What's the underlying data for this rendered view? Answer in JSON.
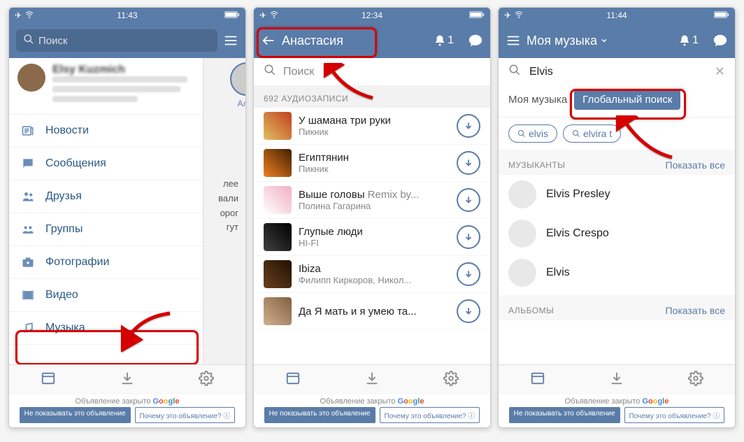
{
  "screen1": {
    "status_time": "11:43",
    "search_placeholder": "Поиск",
    "news": {
      "name": "Elsy Kuzmich",
      "story_name": "Алек"
    },
    "menu": [
      {
        "icon": "newspaper",
        "label": "Новости"
      },
      {
        "icon": "message",
        "label": "Сообщения"
      },
      {
        "icon": "users",
        "label": "Друзья"
      },
      {
        "icon": "group",
        "label": "Группы"
      },
      {
        "icon": "camera",
        "label": "Фотографии"
      },
      {
        "icon": "film",
        "label": "Видео"
      },
      {
        "icon": "music",
        "label": "Музыка"
      }
    ],
    "behind_text": "лее\nвали\nорог\nгут"
  },
  "screen2": {
    "status_time": "12:34",
    "title": "Анастасия",
    "bell_count": "1",
    "search_placeholder": "Поиск",
    "section": "692 АУДИОЗАПИСИ",
    "tracks": [
      {
        "title": "У шамана три руки",
        "artist": "Пикник",
        "grey": ""
      },
      {
        "title": "Египтянин",
        "artist": "Пикник",
        "grey": ""
      },
      {
        "title": "Выше головы",
        "artist": "Полина Гагарина",
        "grey": " Remix by..."
      },
      {
        "title": "Глупые люди",
        "artist": "HI-FI",
        "grey": ""
      },
      {
        "title": "Ibiza",
        "artist": "Филипп Киркоров, Никол...",
        "grey": ""
      },
      {
        "title": "Да Я мать и я умею та...",
        "artist": "",
        "grey": ""
      }
    ]
  },
  "screen3": {
    "status_time": "11:44",
    "title": "Моя музыка",
    "bell_count": "1",
    "search_value": "Elvis",
    "tab_plain": "Моя музыка",
    "tab_active": "Глобальный поиск",
    "pills": [
      "elvis",
      "elvira t"
    ],
    "musicians_label": "МУЗЫКАНТЫ",
    "show_all": "Показать все",
    "artists": [
      "Elvis Presley",
      "Elvis Crespo",
      "Elvis"
    ],
    "albums_label": "АЛЬБОМЫ"
  },
  "footer": {
    "ad_closed": "Объявление закрыто",
    "google": "Google",
    "btn1": "Не показывать это объявление",
    "btn2": "Почему это объявление? ⓘ"
  }
}
